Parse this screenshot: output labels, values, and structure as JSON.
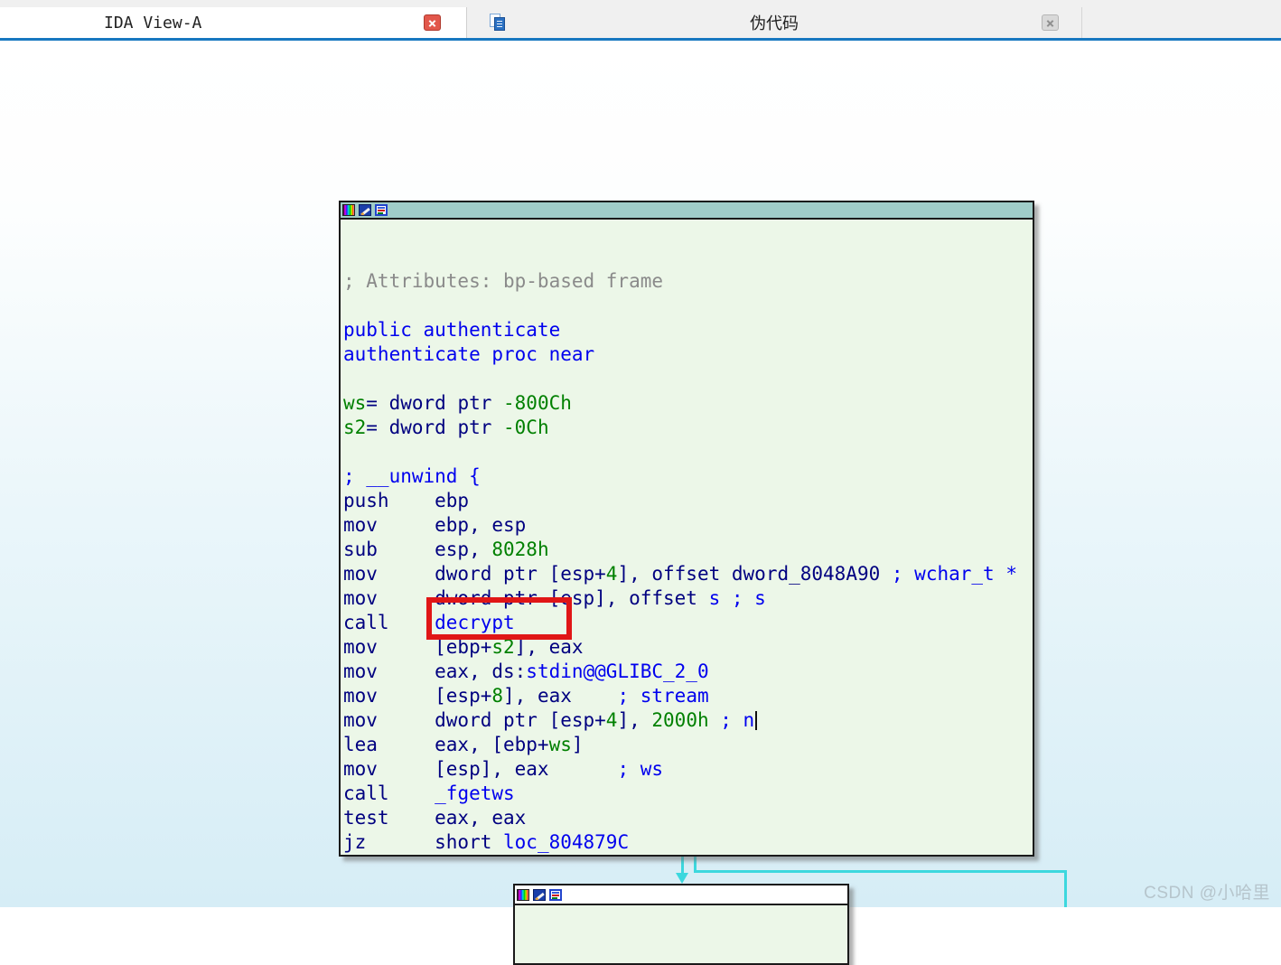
{
  "tabs": [
    {
      "label": "IDA View-A"
    },
    {
      "label": "伪代码"
    }
  ],
  "watermark": "CSDN @小哈里",
  "colors": {
    "tab_accent_line": "#1878c0",
    "active_close": "#e2574b",
    "node_title": "#a0ccc8",
    "node_body": "#ecf7e8",
    "edge": "#3cd8de",
    "highlight_box": "#e01616",
    "code_instruction": "#000080",
    "code_name_comment": "#0000ee",
    "code_number_var": "#008000",
    "code_gray_comment": "#8a8a8a"
  },
  "node1": {
    "icons": [
      "palette-icon",
      "edit-pencil-icon",
      "node-info-icon"
    ],
    "cursor_line_index": 18,
    "code_lines": [
      [
        [
          "; Attributes: bp-based frame",
          "gray"
        ]
      ],
      [],
      [
        [
          "public authenticate",
          "blue"
        ]
      ],
      [
        [
          "authenticate proc near",
          "blue"
        ]
      ],
      [],
      [
        [
          "ws",
          "green"
        ],
        [
          "= dword ptr ",
          "navy"
        ],
        [
          "-800Ch",
          "green"
        ]
      ],
      [
        [
          "s2",
          "green"
        ],
        [
          "= dword ptr ",
          "navy"
        ],
        [
          "-0Ch",
          "green"
        ]
      ],
      [],
      [
        [
          "; __unwind {",
          "blue"
        ]
      ],
      [
        [
          "push    ebp",
          "navy"
        ]
      ],
      [
        [
          "mov     ebp, esp",
          "navy"
        ]
      ],
      [
        [
          "sub     esp, ",
          "navy"
        ],
        [
          "8028h",
          "green"
        ]
      ],
      [
        [
          "mov     dword ptr [esp+",
          "navy"
        ],
        [
          "4",
          "green"
        ],
        [
          "], offset dword_8048A90 ",
          "navy"
        ],
        [
          "; wchar_t *",
          "blue"
        ]
      ],
      [
        [
          "mov     dword ptr [esp], offset ",
          "navy"
        ],
        [
          "s",
          "blue"
        ],
        [
          " ",
          "navy"
        ],
        [
          "; s",
          "blue"
        ]
      ],
      [
        [
          "call    ",
          "navy"
        ],
        [
          "decrypt",
          "blue"
        ]
      ],
      [
        [
          "mov     [ebp+",
          "navy"
        ],
        [
          "s2",
          "green"
        ],
        [
          "], eax",
          "navy"
        ]
      ],
      [
        [
          "mov     eax, ds:",
          "navy"
        ],
        [
          "stdin@@GLIBC_2_0",
          "blue"
        ]
      ],
      [
        [
          "mov     [esp+",
          "navy"
        ],
        [
          "8",
          "green"
        ],
        [
          "], eax    ",
          "navy"
        ],
        [
          "; stream",
          "blue"
        ]
      ],
      [
        [
          "mov     dword ptr [esp+",
          "navy"
        ],
        [
          "4",
          "green"
        ],
        [
          "], ",
          "navy"
        ],
        [
          "2000h",
          "green"
        ],
        [
          " ",
          "navy"
        ],
        [
          "; n",
          "blue"
        ],
        [
          "",
          "caret"
        ]
      ],
      [
        [
          "lea     eax, [ebp+",
          "navy"
        ],
        [
          "ws",
          "green"
        ],
        [
          "]",
          "navy"
        ]
      ],
      [
        [
          "mov     [esp], eax      ",
          "navy"
        ],
        [
          "; ws",
          "blue"
        ]
      ],
      [
        [
          "call    ",
          "navy"
        ],
        [
          "_fgetws",
          "blue"
        ]
      ],
      [
        [
          "test    eax, eax",
          "navy"
        ]
      ],
      [
        [
          "jz      short ",
          "navy"
        ],
        [
          "loc_804879C",
          "blue"
        ]
      ]
    ]
  },
  "node2": {
    "icons": [
      "palette-icon",
      "edit-pencil-icon",
      "node-info-icon"
    ]
  }
}
